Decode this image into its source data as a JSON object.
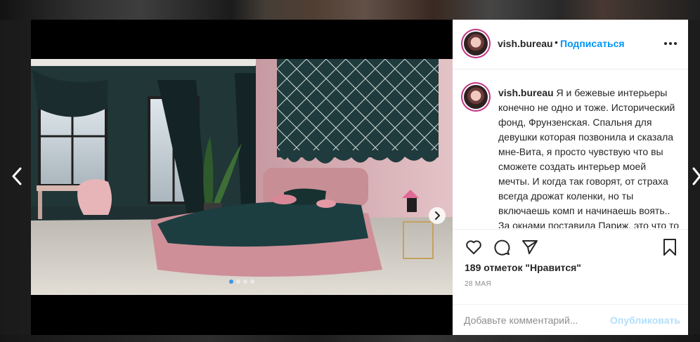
{
  "post": {
    "username": "vish.bureau",
    "header_separator": "•",
    "follow_label": "Подписаться",
    "caption_text": "Я и бежевые интерьеры конечно не одно и тоже. Исторический фонд, Фрунзенская. Спальня для девушки которая позвонила и сказала мне-Вита, я просто чувствую что вы сможете создать интерьер моей мечты. И когда так говорят, от страха всегда дрожат коленки, но ты включаешь комп и начинаешь воять.. За окнами поставила Париж, это что то из",
    "likes_label": "189 отметок \"Нравится\"",
    "date_label": "28 мая",
    "date_label_display": "28 МАЯ",
    "comment_placeholder": "Добавьте комментарий...",
    "publish_label": "Опубликовать",
    "carousel_dots": [
      true,
      false,
      false,
      false
    ]
  },
  "icons": {
    "prev": "chevron-left-icon",
    "next": "chevron-right-icon",
    "more": "more-horizontal-icon",
    "like": "heart-icon",
    "comment": "comment-icon",
    "share": "paper-plane-icon",
    "save": "bookmark-icon"
  },
  "colors": {
    "link_blue": "#0095f6",
    "publish_disabled": "#b2dffc",
    "text_primary": "#262626",
    "text_secondary": "#8e8e8e",
    "dot_active": "#3897f0"
  }
}
